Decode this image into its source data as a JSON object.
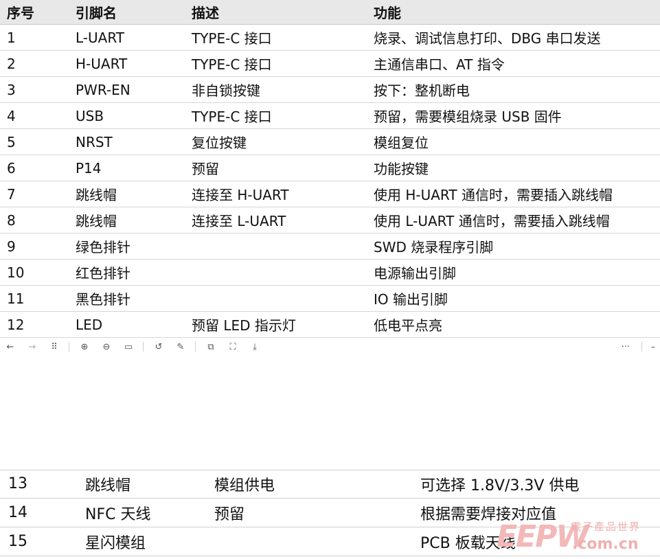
{
  "table1": {
    "headers": [
      "序号",
      "引脚名",
      "描述",
      "功能"
    ],
    "rows": [
      [
        "1",
        "L-UART",
        "TYPE-C 接口",
        "烧录、调试信息打印、DBG 串口发送"
      ],
      [
        "2",
        "H-UART",
        "TYPE-C 接口",
        "主通信串口、AT 指令"
      ],
      [
        "3",
        "PWR-EN",
        "非自锁按键",
        "按下：整机断电"
      ],
      [
        "4",
        "USB",
        "TYPE-C 接口",
        "预留，需要模组烧录 USB 固件"
      ],
      [
        "5",
        "NRST",
        "复位按键",
        "模组复位"
      ],
      [
        "6",
        "P14",
        "预留",
        "功能按键"
      ],
      [
        "7",
        "跳线帽",
        "连接至 H-UART",
        "使用 H-UART 通信时，需要插入跳线帽"
      ],
      [
        "8",
        "跳线帽",
        "连接至 L-UART",
        "使用 L-UART 通信时，需要插入跳线帽"
      ],
      [
        "9",
        "绿色排针",
        "",
        "SWD 烧录程序引脚"
      ],
      [
        "10",
        "红色排针",
        "",
        "电源输出引脚"
      ],
      [
        "11",
        "黑色排针",
        "",
        "IO 输出引脚"
      ],
      [
        "12",
        "LED",
        "预留 LED 指示灯",
        "低电平点亮"
      ]
    ]
  },
  "toolbar": {
    "back": "←",
    "forward": "→",
    "grid": "⠿",
    "zoom_in": "⊕",
    "zoom_out": "⊖",
    "fit": "▭",
    "rotate": "↺",
    "edit": "✎",
    "crop": "⧉",
    "expand": "⛶",
    "download": "⤓",
    "more": "···",
    "extra": "–"
  },
  "table2": {
    "rows": [
      [
        "13",
        "跳线帽",
        "模组供电",
        "可选择 1.8V/3.3V 供电"
      ],
      [
        "14",
        "NFC 天线",
        "预留",
        "根据需要焊接对应值"
      ],
      [
        "15",
        "星闪模组",
        "",
        "PCB 板载天线"
      ]
    ]
  },
  "watermark": {
    "brand": "EEPW",
    "cn": "電子產品世界",
    "domain": ".com.cn"
  }
}
